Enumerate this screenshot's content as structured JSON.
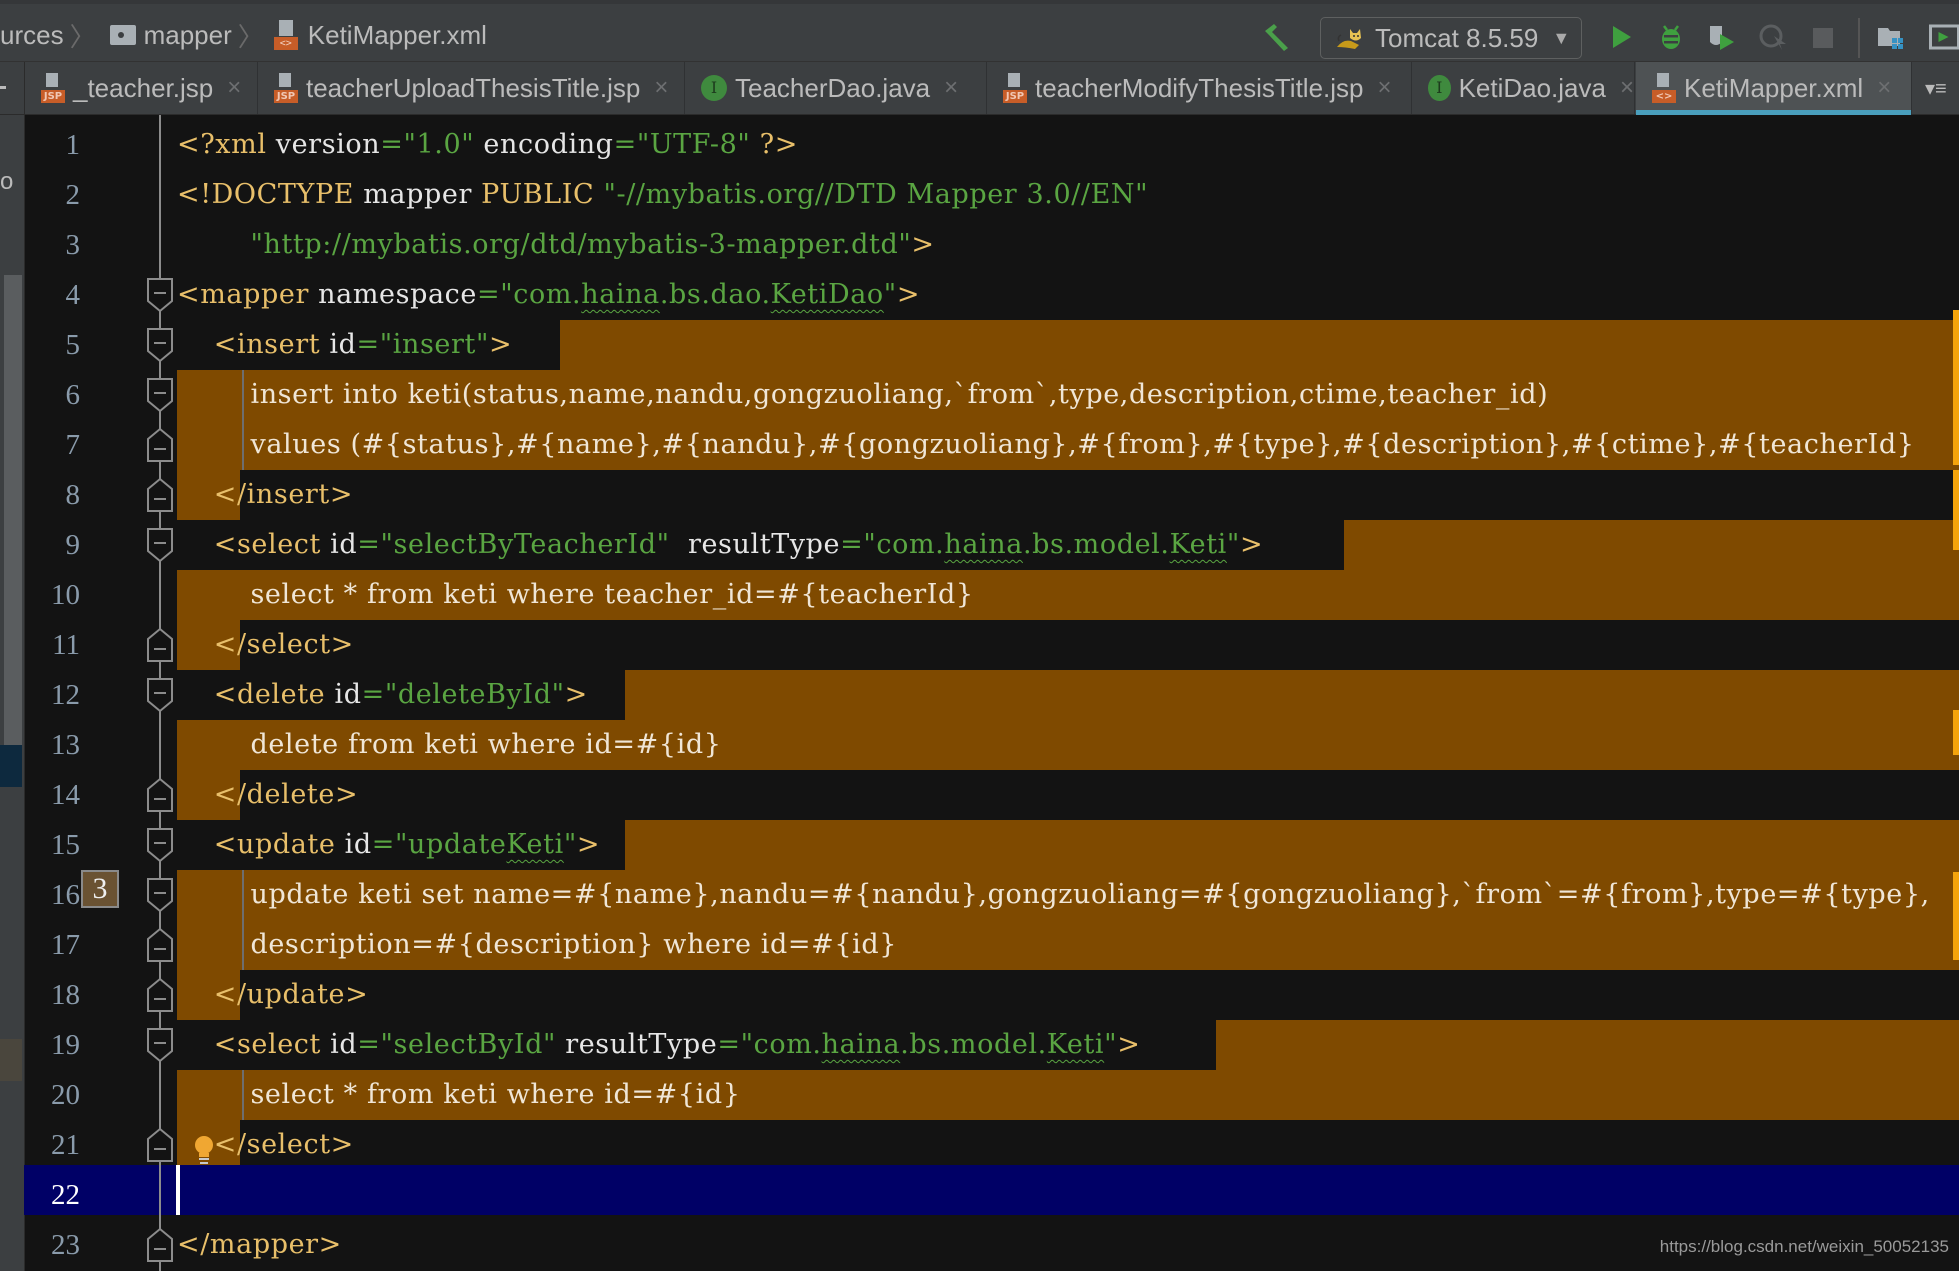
{
  "breadcrumb": {
    "items": [
      {
        "label": "urces",
        "icon": "none"
      },
      {
        "label": "mapper",
        "icon": "folder-icon"
      },
      {
        "label": "KetiMapper.xml",
        "icon": "xml-file-icon"
      }
    ]
  },
  "toolbar": {
    "run_config": "Tomcat 8.5.59",
    "buttons": [
      "build-hammer",
      "run",
      "debug",
      "run-with-coverage",
      "profile",
      "stop",
      "project-structure",
      "run-window"
    ]
  },
  "tabs": [
    {
      "label": "_teacher.jsp",
      "icon": "jsp-file-icon",
      "active": false
    },
    {
      "label": "teacherUploadThesisTitle.jsp",
      "icon": "jsp-file-icon",
      "active": false
    },
    {
      "label": "TeacherDao.java",
      "icon": "interface-icon",
      "active": false
    },
    {
      "label": "teacherModifyThesisTitle.jsp",
      "icon": "jsp-file-icon",
      "active": false
    },
    {
      "label": "KetiDao.java",
      "icon": "interface-icon",
      "active": false
    },
    {
      "label": "KetiMapper.xml",
      "icon": "xml-file-icon",
      "active": true
    }
  ],
  "tab_close_glyph": "×",
  "tab_overflow_glyph": "▾≡",
  "jsp_badge": "JSP",
  "xml_badge": "<>",
  "interface_badge": "I",
  "editor": {
    "line_numbers": [
      "1",
      "2",
      "3",
      "4",
      "5",
      "6",
      "7",
      "8",
      "9",
      "10",
      "11",
      "12",
      "13",
      "14",
      "15",
      "16",
      "17",
      "18",
      "19",
      "20",
      "21",
      "22",
      "23"
    ],
    "current_line": 22,
    "inlay_hint": "3",
    "inlay_line": 16,
    "lines": {
      "l1": {
        "p1": "<?xml ",
        "p2": "version",
        "p3": "=",
        "p4": "\"1.0\"",
        "p5": " encoding",
        "p6": "=",
        "p7": "\"UTF-8\"",
        "p8": " ?>"
      },
      "l2": {
        "p1": "<!DOCTYPE ",
        "p2": "mapper ",
        "p3": "PUBLIC ",
        "p4": "\"-//mybatis.org//DTD Mapper 3.0//EN\""
      },
      "l3": {
        "p1": "        ",
        "p2": "\"http://mybatis.org/dtd/mybatis-3-mapper.dtd\"",
        "p3": ">"
      },
      "l4": {
        "p1": "<mapper ",
        "p2": "namespace",
        "p3": "=",
        "p4": "\"com.",
        "p5": "haina",
        "p6": ".bs.dao.",
        "p7": "KetiDao",
        "p8": "\"",
        "p9": ">"
      },
      "l5": {
        "p1": "    <insert ",
        "p2": "id",
        "p3": "=",
        "p4": "\"insert\"",
        "p5": ">"
      },
      "l6": "        insert into keti(status,name,nandu,gongzuoliang,`from`,type,description,ctime,teacher_id)",
      "l7": "        values (#{status},#{name},#{nandu},#{gongzuoliang},#{from},#{type},#{description},#{ctime},#{teacherId}",
      "l8": {
        "p1": "    </insert>"
      },
      "l9": {
        "p1": "    <select ",
        "p2": "id",
        "p3": "=",
        "p4": "\"selectByTeacherId\"",
        "p5": "  resultType",
        "p6": "=",
        "p7": "\"com.",
        "p8": "haina",
        "p9": ".bs.model.",
        "p10": "Keti",
        "p11": "\"",
        "p12": ">"
      },
      "l10": "        select * from keti where teacher_id=#{teacherId}",
      "l11": {
        "p1": "    </select>"
      },
      "l12": {
        "p1": "    <delete ",
        "p2": "id",
        "p3": "=",
        "p4": "\"deleteById\"",
        "p5": ">"
      },
      "l13": "        delete from keti where id=#{id}",
      "l14": {
        "p1": "    </delete>"
      },
      "l15": {
        "p1": "    <update ",
        "p2": "id",
        "p3": "=",
        "p4": "\"update",
        "p5": "Keti",
        "p6": "\"",
        "p7": ">"
      },
      "l16": "        update keti set name=#{name},nandu=#{nandu},gongzuoliang=#{gongzuoliang},`from`=#{from},type=#{type},",
      "l17": "        description=#{description} where id=#{id}",
      "l18": {
        "p1": "    </update>"
      },
      "l19": {
        "p1": "    <select ",
        "p2": "id",
        "p3": "=",
        "p4": "\"selectById\"",
        "p5": " resultType",
        "p6": "=",
        "p7": "\"com.",
        "p8": "haina",
        "p9": ".bs.model.",
        "p10": "Keti",
        "p11": "\"",
        "p12": ">"
      },
      "l20": "        select * from keti where id=#{id}",
      "l21": {
        "p1": "    </select>"
      },
      "l22": "",
      "l23": {
        "p1": "</mapper>"
      }
    }
  },
  "colors": {
    "tag": "#e8bf6a",
    "attribute": "#e6e6e6",
    "string": "#5aa542",
    "highlight": "#7f4a00",
    "current_line": "#000066",
    "active_tab_underline": "#4a9fbd"
  },
  "left_panel_fragment": "o",
  "watermark": "https://blog.csdn.net/weixin_50052135"
}
